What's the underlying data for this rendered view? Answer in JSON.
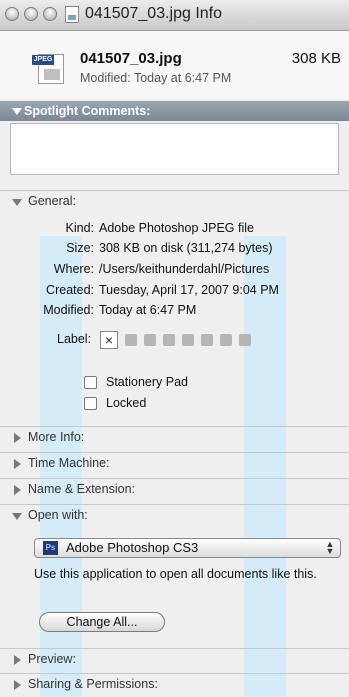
{
  "window": {
    "title": "041507_03.jpg Info"
  },
  "header": {
    "file_name": "041507_03.jpg",
    "file_size": "308 KB",
    "modified": "Modified: Today at 6:47 PM",
    "icon_badge": "JPEG"
  },
  "spotlight": {
    "label": "Spotlight Comments:"
  },
  "general": {
    "label": "General:",
    "rows": [
      {
        "key": "Kind:",
        "value": "Adobe Photoshop JPEG file"
      },
      {
        "key": "Size:",
        "value": "308 KB on disk (311,274 bytes)"
      },
      {
        "key": "Where:",
        "value": "/Users/keithunderdahl/Pictures"
      },
      {
        "key": "Created:",
        "value": "Tuesday, April 17, 2007 9:04 PM"
      },
      {
        "key": "Modified:",
        "value": "Today at 6:47 PM"
      }
    ],
    "label_key": "Label:",
    "label_none": "×",
    "stationery": "Stationery Pad",
    "locked": "Locked"
  },
  "sections": {
    "more_info": "More Info:",
    "time_machine": "Time Machine:",
    "name_ext": "Name & Extension:",
    "open_with": "Open with:",
    "preview": "Preview:",
    "sharing": "Sharing & Permissions:"
  },
  "open_with": {
    "app": "Adobe Photoshop CS3",
    "app_icon": "Ps",
    "description": "Use this application to open all documents like this.",
    "change_all": "Change All..."
  }
}
